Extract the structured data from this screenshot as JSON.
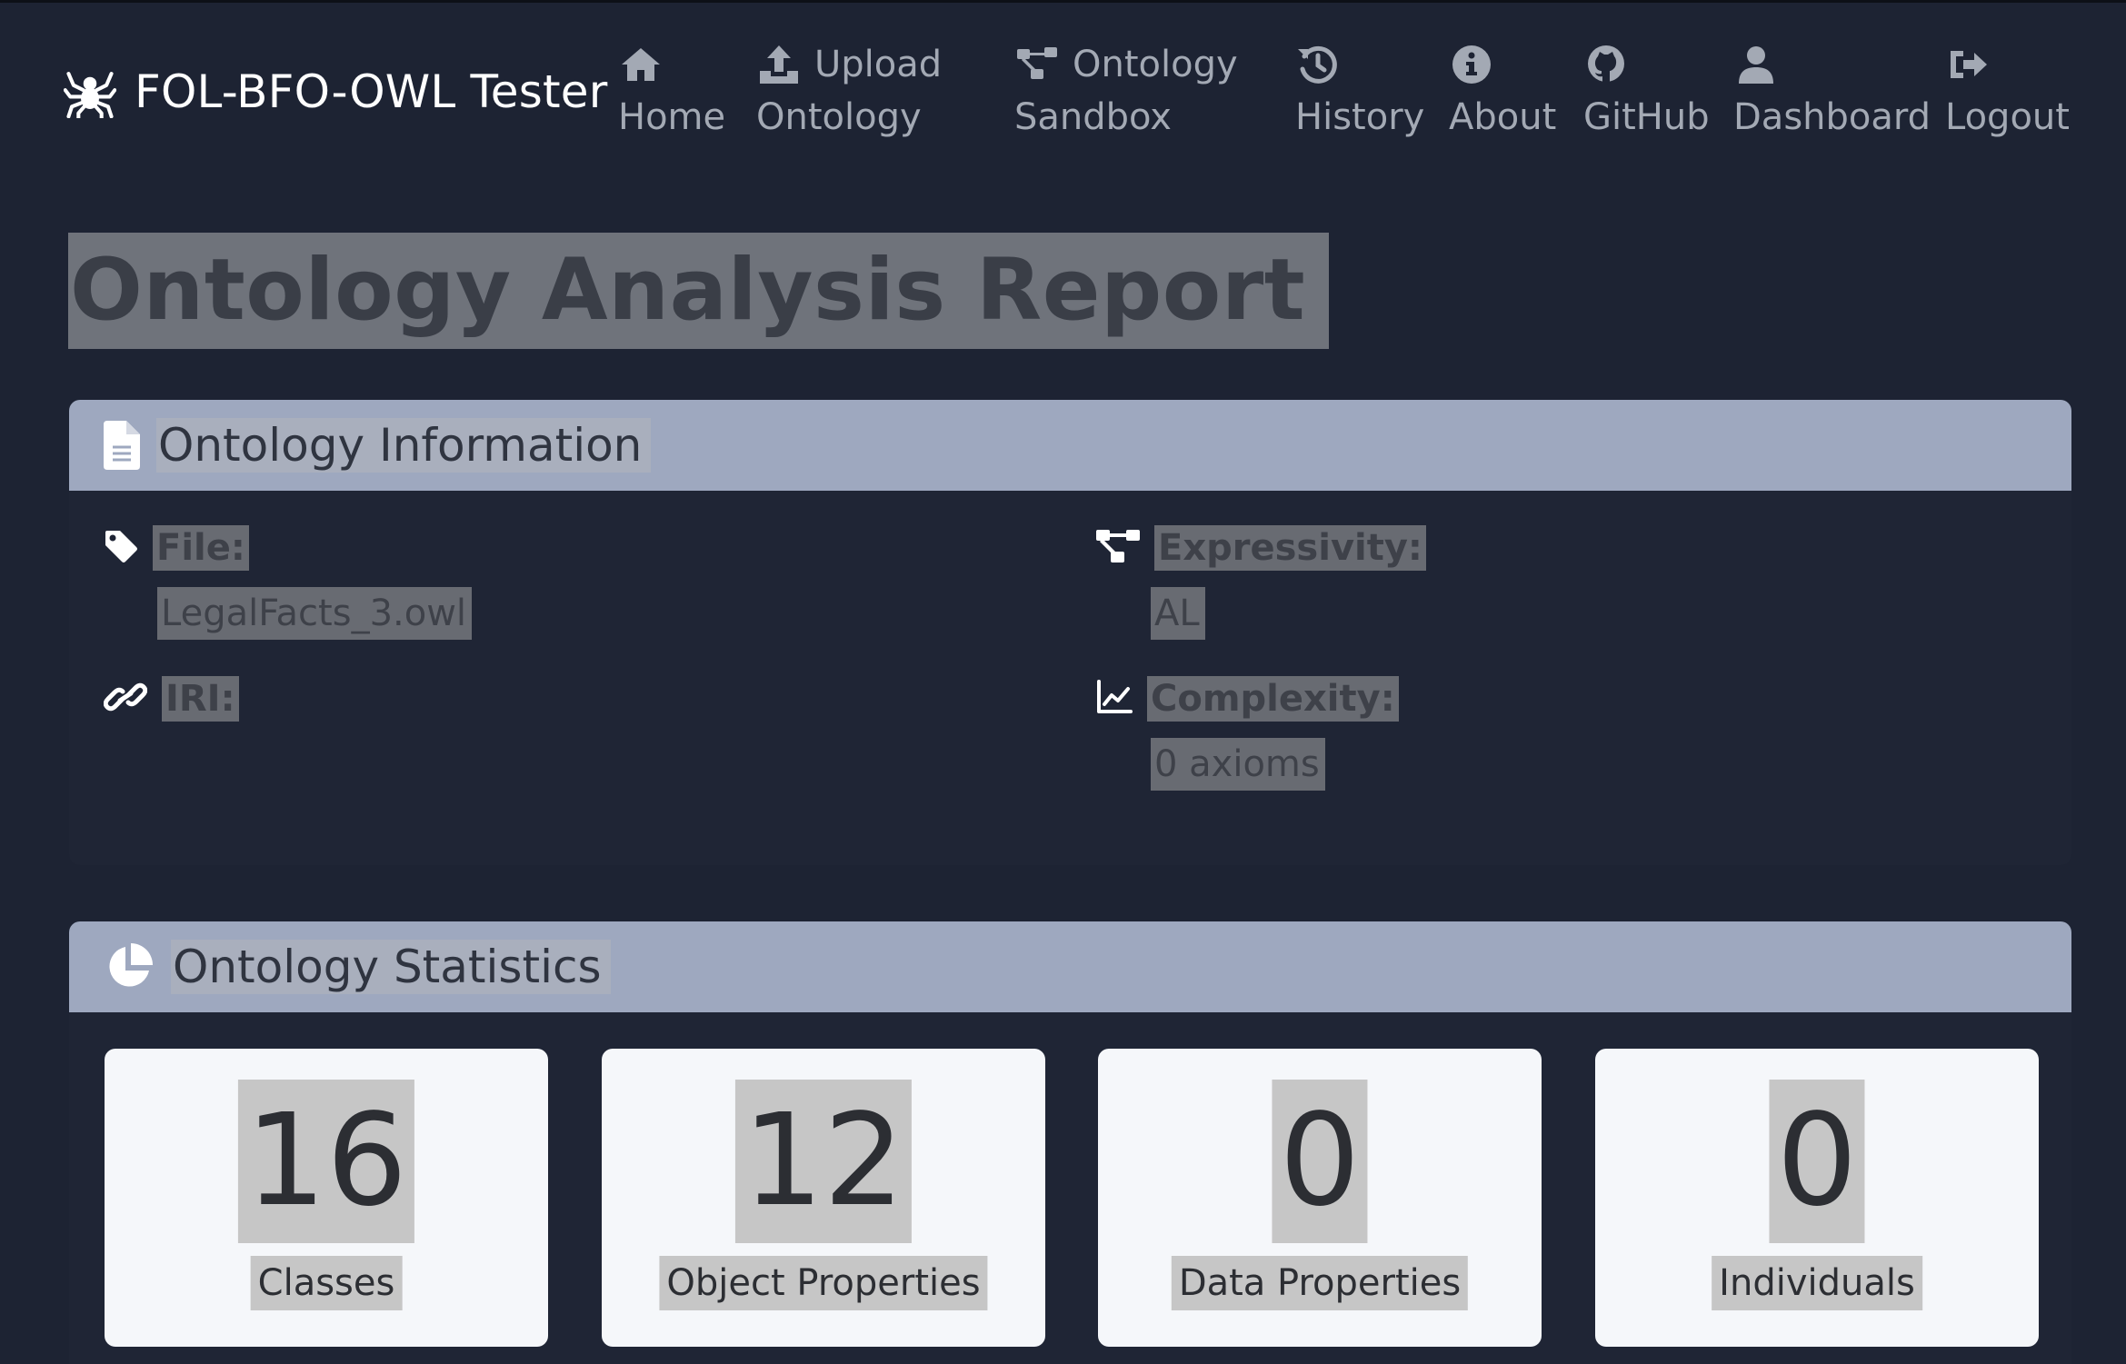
{
  "navbar": {
    "brand": {
      "label": "FOL-BFO-OWL Tester",
      "icon": "spider-icon"
    },
    "items": [
      {
        "line1": "",
        "line2": "Home",
        "icon": "home-icon"
      },
      {
        "line1": "Upload",
        "line2": "Ontology",
        "icon": "upload-icon"
      },
      {
        "line1": "Ontology",
        "line2": "Sandbox",
        "icon": "sitemap-icon"
      },
      {
        "line1": "",
        "line2": "History",
        "icon": "history-icon"
      },
      {
        "line1": "",
        "line2": "About",
        "icon": "info-circle-icon"
      },
      {
        "line1": "",
        "line2": "GitHub",
        "icon": "github-icon"
      },
      {
        "line1": "",
        "line2": "Dashboard",
        "icon": "user-icon"
      },
      {
        "line1": "",
        "line2": "Logout",
        "icon": "sign-out-icon"
      }
    ]
  },
  "page": {
    "title": "Ontology Analysis Report"
  },
  "info": {
    "header": "Ontology Information",
    "file_label": "File:",
    "file_value": "LegalFacts_3.owl",
    "iri_label": "IRI:",
    "iri_value": "",
    "expressivity_label": "Expressivity:",
    "expressivity_value": "AL",
    "complexity_label": "Complexity:",
    "complexity_value": "0 axioms"
  },
  "stats": {
    "header": "Ontology Statistics",
    "items": [
      {
        "value": "16",
        "label": "Classes"
      },
      {
        "value": "12",
        "label": "Object Properties"
      },
      {
        "value": "0",
        "label": "Data Properties"
      },
      {
        "value": "0",
        "label": "Individuals"
      }
    ]
  },
  "colors": {
    "background": "#1d2333",
    "card_header": "#9ea8bf",
    "nav_text": "#a3a9b4",
    "stat_box": "#f5f7fa"
  }
}
